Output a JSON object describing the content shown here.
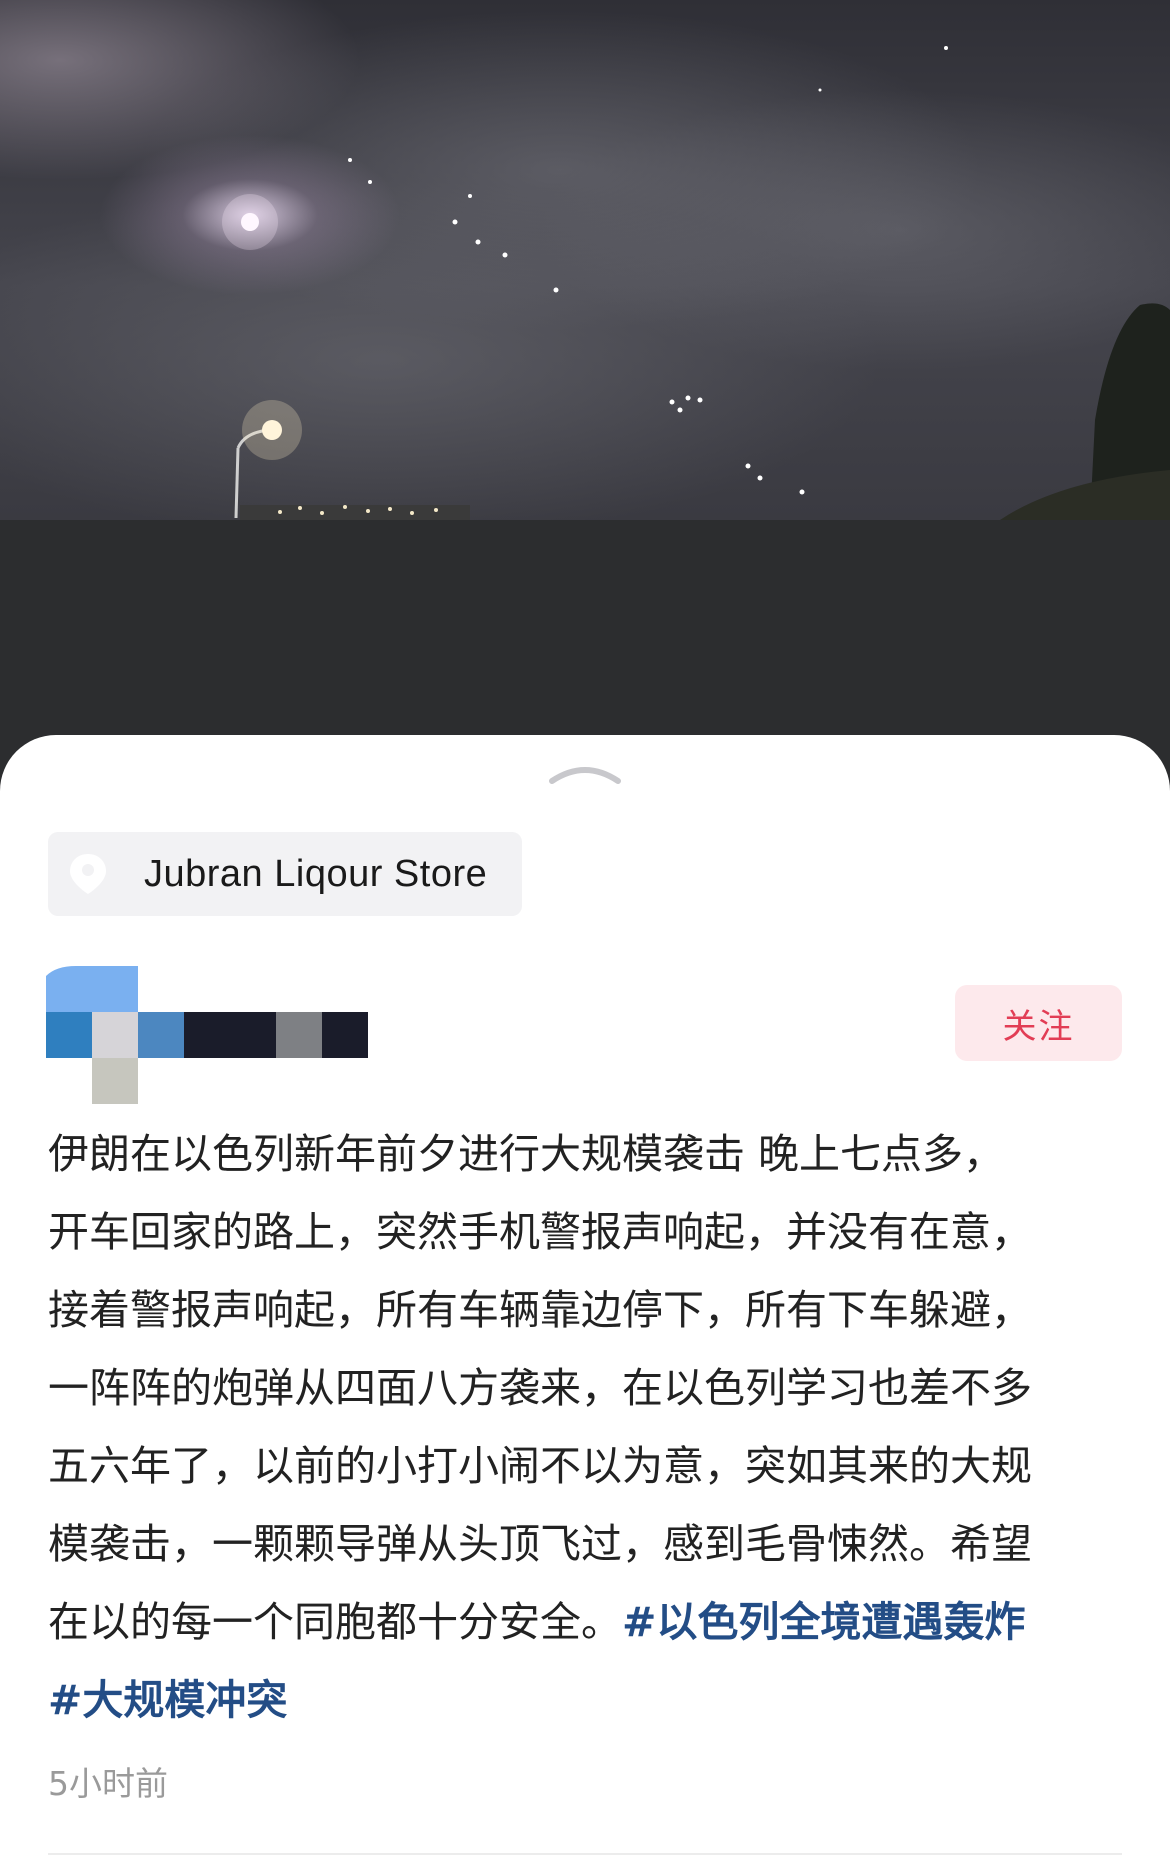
{
  "location": {
    "icon": "location-pin-icon",
    "name": "Jubran Liqour Store"
  },
  "author": {
    "avatar": "pixelated-avatar"
  },
  "follow_button": {
    "label": "关注",
    "color": "#e23d55",
    "background": "#fde9ec"
  },
  "post": {
    "lines": [
      "伊朗在以色列新年前夕进行大规模袭击 晚上七点多，",
      "开车回家的路上，突然手机警报声响起，并没有在意，",
      "接着警报声响起，所有车辆靠边停下，所有下车躲避，",
      "一阵阵的炮弹从四面八方袭来，在以色列学习也差不多",
      "五六年了，以前的小打小闹不以为意，突如其来的大规",
      "模袭击，一颗颗导弹从头顶飞过，感到毛骨悚然。希望"
    ],
    "last_line_text": "在以的每一个同胞都十分安全。",
    "hashtags": [
      "#以色列全境遭遇轰炸",
      "#大规模冲突"
    ],
    "hashtag_color": "#234d86"
  },
  "timestamp": "5小时前",
  "photo": {
    "description_icon": "night-sky-photo",
    "handle_icon": "chevron-up-icon"
  }
}
